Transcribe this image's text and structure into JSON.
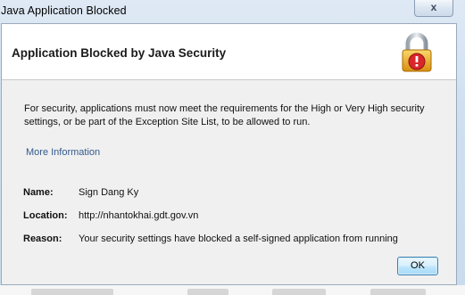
{
  "window": {
    "title": "Java Application Blocked",
    "close_glyph": "x"
  },
  "header": {
    "title": "Application Blocked by Java Security",
    "icon": "lock-warning-icon"
  },
  "message": "For security, applications must now meet the requirements for the High or Very High security settings, or be part of the Exception Site List, to be allowed to run.",
  "more_info_link": "More Information",
  "details": [
    {
      "label": "Name:",
      "value": "Sign Dang Ky"
    },
    {
      "label": "Location:",
      "value": "http://nhantokhai.gdt.gov.vn"
    },
    {
      "label": "Reason:",
      "value": "Your security settings have blocked a self-signed application from running"
    }
  ],
  "ok_button": "OK",
  "colors": {
    "link": "#33598c",
    "lock_body": "#e8a317",
    "warning_badge": "#d9262b"
  }
}
